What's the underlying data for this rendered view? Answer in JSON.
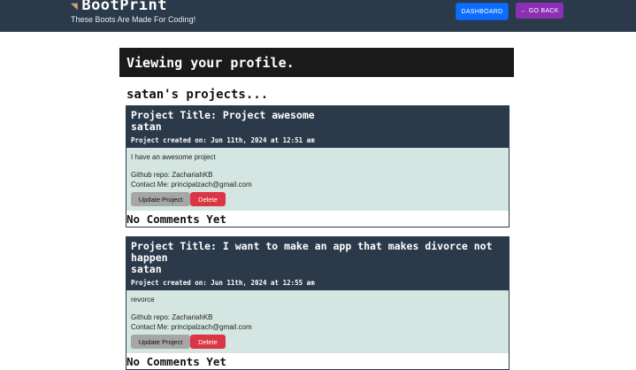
{
  "header": {
    "brand": "BootPrint",
    "brand_icon": "boot-icon",
    "tagline": "These Boots Are Made For Coding!",
    "dashboard_label": "DASHBOARD",
    "back_label": "← GO BACK"
  },
  "main": {
    "view_title": "Viewing your profile.",
    "projects_heading": "satan's projects..."
  },
  "projects": [
    {
      "title": "Project Title: Project awesome",
      "author": "satan",
      "created": "Project created on: Jun 11th, 2024 at 12:51 am",
      "description": "I have an awesome project",
      "github": "Github repo: ZachariahKB",
      "contact": "Contact Me: principalzach@gmail.com",
      "update_label": "Update Project",
      "delete_label": "Delete",
      "comments": "No Comments Yet"
    },
    {
      "title": "Project Title: I want to make an app that makes divorce not happen",
      "author": "satan",
      "created": "Project created on: Jun 11th, 2024 at 12:55 am",
      "description": "revorce",
      "github": "Github repo: ZachariahKB",
      "contact": "Contact Me: principalzach@gmail.com",
      "update_label": "Update Project",
      "delete_label": "Delete",
      "comments": "No Comments Yet"
    }
  ]
}
